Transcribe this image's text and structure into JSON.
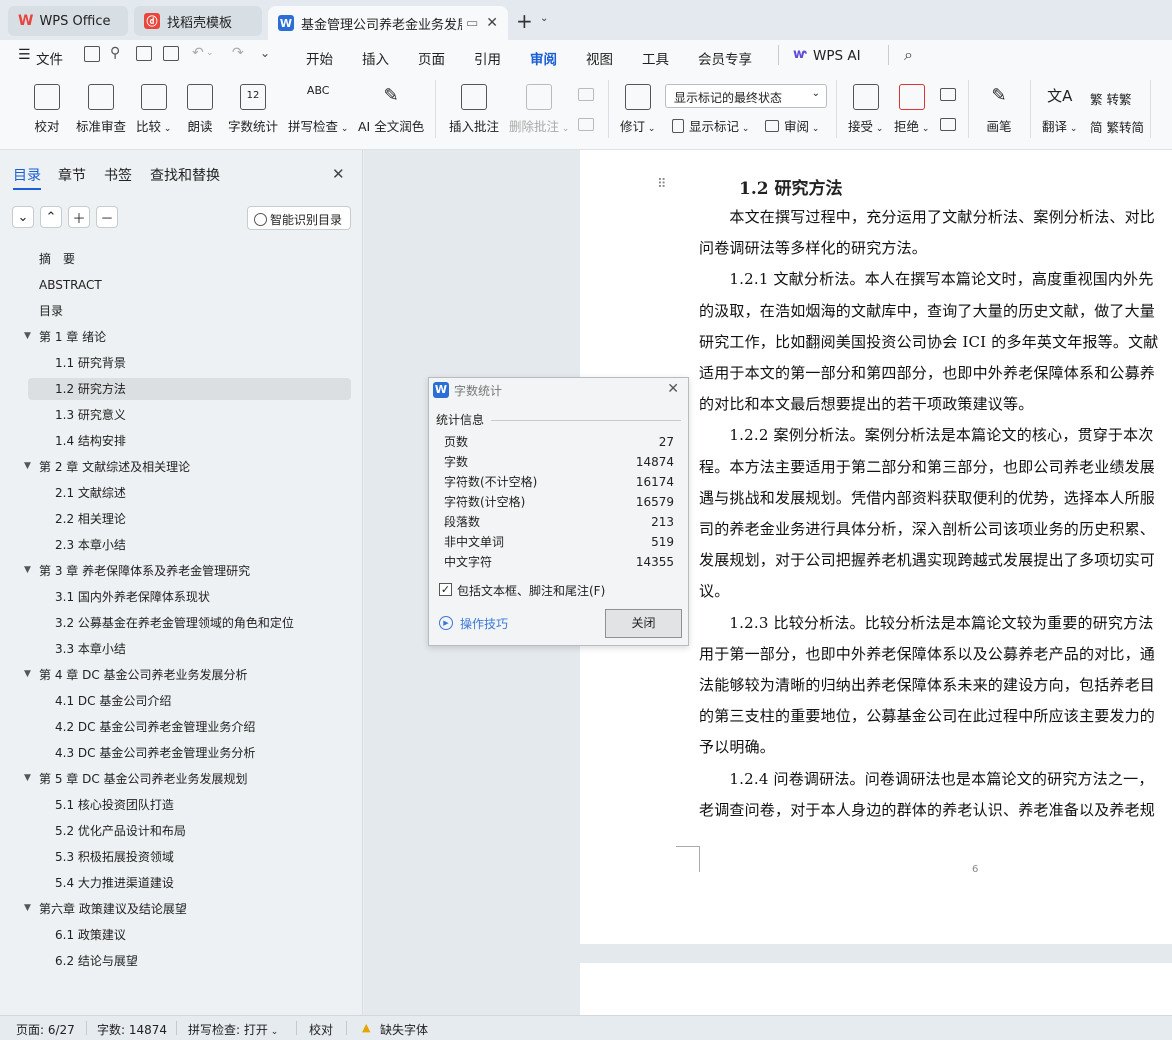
{
  "tabs": [
    {
      "label": "WPS Office"
    },
    {
      "label": "找稻壳模板"
    },
    {
      "label": "基金管理公司养老金业务发展"
    }
  ],
  "new_tab": "+",
  "menu": {
    "file": "文件",
    "items": [
      "开始",
      "插入",
      "页面",
      "引用",
      "审阅",
      "视图",
      "工具",
      "会员专享",
      "WPS AI"
    ],
    "active": "审阅"
  },
  "ribbon": {
    "proofread": "校对",
    "std_review": "标准审查",
    "compare": "比较",
    "read_aloud": "朗读",
    "word_count": "字数统计",
    "spell_check": "拼写检查",
    "ai_polish": "AI 全文润色",
    "insert_comment": "插入批注",
    "delete_comment": "删除批注",
    "revise": "修订",
    "markup_select": "显示标记的最终状态",
    "show_markup": "显示标记",
    "review": "审阅",
    "accept": "接受",
    "reject": "拒绝",
    "pen": "画笔",
    "translate": "翻译",
    "to_traditional": "转繁",
    "to_simplified": "繁转简"
  },
  "nav": {
    "tabs": [
      "目录",
      "章节",
      "书签",
      "查找和替换"
    ],
    "smart_btn": "智能识别目录",
    "items": [
      {
        "label": "摘　要",
        "level": 0
      },
      {
        "label": "ABSTRACT",
        "level": 0
      },
      {
        "label": "目录",
        "level": 0
      },
      {
        "label": "第 1 章  绪论",
        "level": 1
      },
      {
        "label": "1.1  研究背景",
        "level": 2
      },
      {
        "label": "1.2  研究方法",
        "level": 2,
        "selected": true
      },
      {
        "label": "1.3  研究意义",
        "level": 2
      },
      {
        "label": "1.4  结构安排",
        "level": 2
      },
      {
        "label": "第 2 章  文献综述及相关理论",
        "level": 1
      },
      {
        "label": "2.1 文献综述",
        "level": 2
      },
      {
        "label": "2.2  相关理论",
        "level": 2
      },
      {
        "label": "2.3  本章小结",
        "level": 2
      },
      {
        "label": "第 3 章  养老保障体系及养老金管理研究",
        "level": 1
      },
      {
        "label": "3.1  国内外养老保障体系现状",
        "level": 2
      },
      {
        "label": "3.2  公募基金在养老金管理领域的角色和定位",
        "level": 2
      },
      {
        "label": "3.3  本章小结",
        "level": 2
      },
      {
        "label": "第 4 章  DC 基金公司养老业务发展分析",
        "level": 1
      },
      {
        "label": "4.1 DC 基金公司介绍",
        "level": 2
      },
      {
        "label": "4.2 DC 基金公司养老金管理业务介绍",
        "level": 2
      },
      {
        "label": "4.3 DC 基金公司养老金管理业务分析",
        "level": 2
      },
      {
        "label": "第 5 章  DC 基金公司养老业务发展规划",
        "level": 1
      },
      {
        "label": "5.1  核心投资团队打造",
        "level": 2
      },
      {
        "label": "5.2  优化产品设计和布局",
        "level": 2
      },
      {
        "label": "5.3  积极拓展投资领域",
        "level": 2
      },
      {
        "label": "5.4  大力推进渠道建设",
        "level": 2
      },
      {
        "label": "第六章  政策建议及结论展望",
        "level": 1
      },
      {
        "label": "6.1  政策建议",
        "level": 2
      },
      {
        "label": "6.2  结论与展望",
        "level": 2
      }
    ]
  },
  "document": {
    "heading": "1.2  研究方法",
    "lines": [
      "　　本文在撰写过程中，充分运用了文献分析法、案例分析法、对比",
      "问卷调研法等多样化的研究方法。",
      "　　1.2.1  文献分析法。本人在撰写本篇论文时，高度重视国内外先",
      "的汲取，在浩如烟海的文献库中，查询了大量的历史文献，做了大量",
      "研究工作，比如翻阅美国投资公司协会 ICI 的多年英文年报等。文献",
      "适用于本文的第一部分和第四部分，也即中外养老保障体系和公募养",
      "的对比和本文最后想要提出的若干项政策建议等。",
      "　　1.2.2  案例分析法。案例分析法是本篇论文的核心，贯穿于本次",
      "程。本方法主要适用于第二部分和第三部分，也即公司养老业绩发展",
      "遇与挑战和发展规划。凭借内部资料获取便利的优势，选择本人所服",
      "司的养老金业务进行具体分析，深入剖析公司该项业务的历史积累、",
      "发展规划，对于公司把握养老机遇实现跨越式发展提出了多项切实可",
      "议。",
      "　　1.2.3  比较分析法。比较分析法是本篇论文较为重要的研究方法",
      "用于第一部分，也即中外养老保障体系以及公募养老产品的对比，通",
      "法能够较为清晰的归纳出养老保障体系未来的建设方向，包括养老目",
      "的第三支柱的重要地位，公募基金公司在此过程中所应该主要发力的",
      "予以明确。",
      "　　1.2.4  问卷调研法。问卷调研法也是本篇论文的研究方法之一，",
      "老调查问卷，对于本人身边的群体的养老认识、养老准备以及养老规"
    ],
    "page_number": "6"
  },
  "dialog": {
    "title": "字数统计",
    "section": "统计信息",
    "stats": [
      {
        "label": "页数",
        "value": "27"
      },
      {
        "label": "字数",
        "value": "14874"
      },
      {
        "label": "字符数(不计空格)",
        "value": "16174"
      },
      {
        "label": "字符数(计空格)",
        "value": "16579"
      },
      {
        "label": "段落数",
        "value": "213"
      },
      {
        "label": "非中文单词",
        "value": "519"
      },
      {
        "label": "中文字符",
        "value": "14355"
      }
    ],
    "checkbox_label": "包括文本框、脚注和尾注(F)",
    "checkbox_checked": true,
    "tips_link": "操作技巧",
    "close_btn": "关闭"
  },
  "status": {
    "page": "页面: 6/27",
    "words": "字数: 14874",
    "spell": "拼写检查: 打开",
    "proof": "校对",
    "missing_font": "缺失字体"
  },
  "colors": {
    "accent": "#1a5fd6",
    "wps_red": "#e8453c",
    "word_blue": "#2b6fd6"
  }
}
